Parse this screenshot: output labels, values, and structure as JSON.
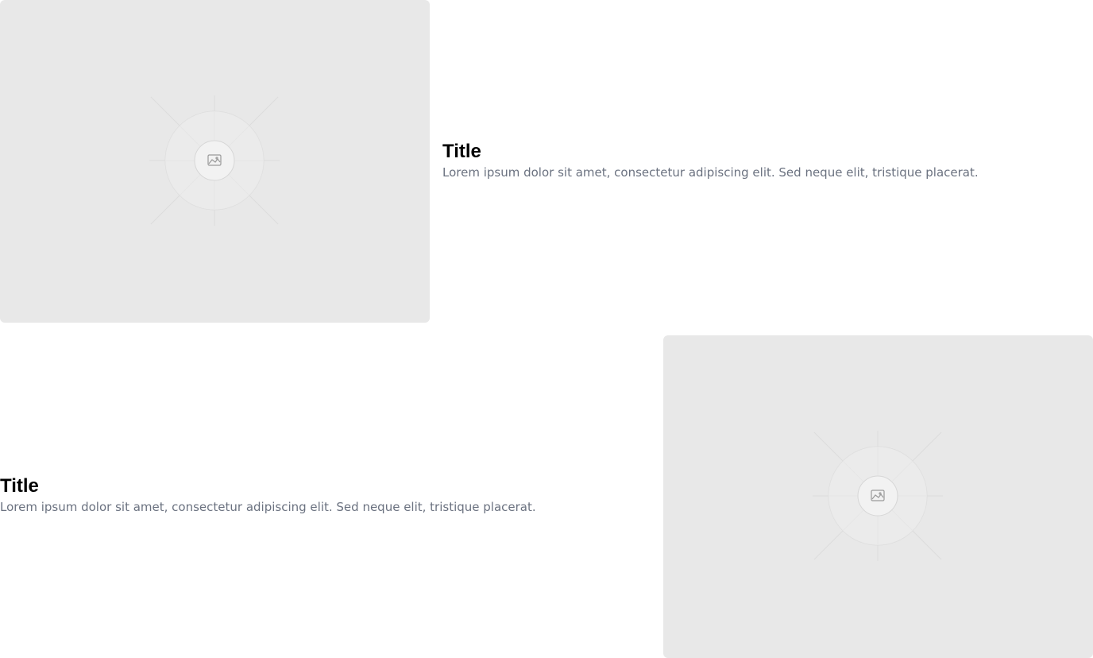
{
  "items": [
    {
      "image_icon": "image-icon",
      "title": "Title",
      "description": "Lorem ipsum dolor sit amet, consectetur adipiscing elit. Sed neque elit, tristique placerat."
    },
    {
      "image_icon": "image-icon",
      "title": "Title",
      "description": "Lorem ipsum dolor sit amet, consectetur adipiscing elit. Sed neque elit, tristique placerat."
    }
  ],
  "colors": {
    "placeholder_bg": "#e8e8e8",
    "title": "#000000",
    "description": "#6b7280"
  }
}
